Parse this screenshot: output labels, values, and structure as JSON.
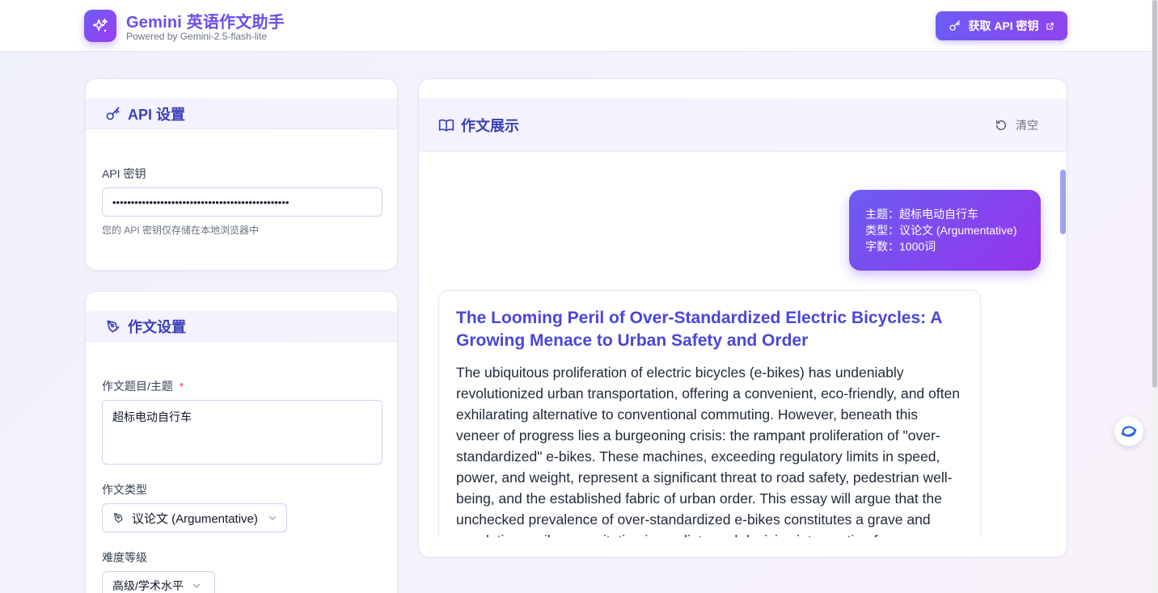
{
  "header": {
    "title": "Gemini 英语作文助手",
    "subtitle": "Powered by Gemini-2.5-flash-lite",
    "api_key_button": "获取 API 密钥"
  },
  "api_settings": {
    "title": "API 设置",
    "key_label": "API 密钥",
    "key_value": "••••••••••••••••••••••••••••••••••••••••••••••••",
    "hint": "您的 API 密钥仅存储在本地浏览器中"
  },
  "essay_settings": {
    "title": "作文设置",
    "topic_label": "作文题目/主题",
    "required_mark": "*",
    "topic_value": "超标电动自行车",
    "type_label": "作文类型",
    "type_value": "议论文 (Argumentative)",
    "level_label": "难度等级",
    "level_value": "高级/学术水平"
  },
  "display": {
    "title": "作文展示",
    "clear_label": "清空",
    "request": {
      "topic_line": "主题：超标电动自行车",
      "type_line": "类型：议论文 (Argumentative)",
      "words_line": "字数：1000词"
    },
    "essay": {
      "title": "The Looming Peril of Over-Standardized Electric Bicycles: A Growing Menace to Urban Safety and Order",
      "body": "The ubiquitous proliferation of electric bicycles (e-bikes) has undeniably revolutionized urban transportation, offering a convenient, eco-friendly, and often exhilarating alternative to conventional commuting. However, beneath this veneer of progress lies a burgeoning crisis: the rampant proliferation of \"over-standardized\" e-bikes. These machines, exceeding regulatory limits in speed, power, and weight, represent a significant threat to road safety, pedestrian well-being, and the established fabric of urban order. This essay will argue that the unchecked prevalence of over-standardized e-bikes constitutes a grave and escalating peril, necessitating immediate and decisive intervention from"
    }
  },
  "colors": {
    "accent": "#6c5cf3",
    "accent_end": "#9634ea",
    "heading": "#3b3fb8",
    "required": "#ef4444"
  }
}
